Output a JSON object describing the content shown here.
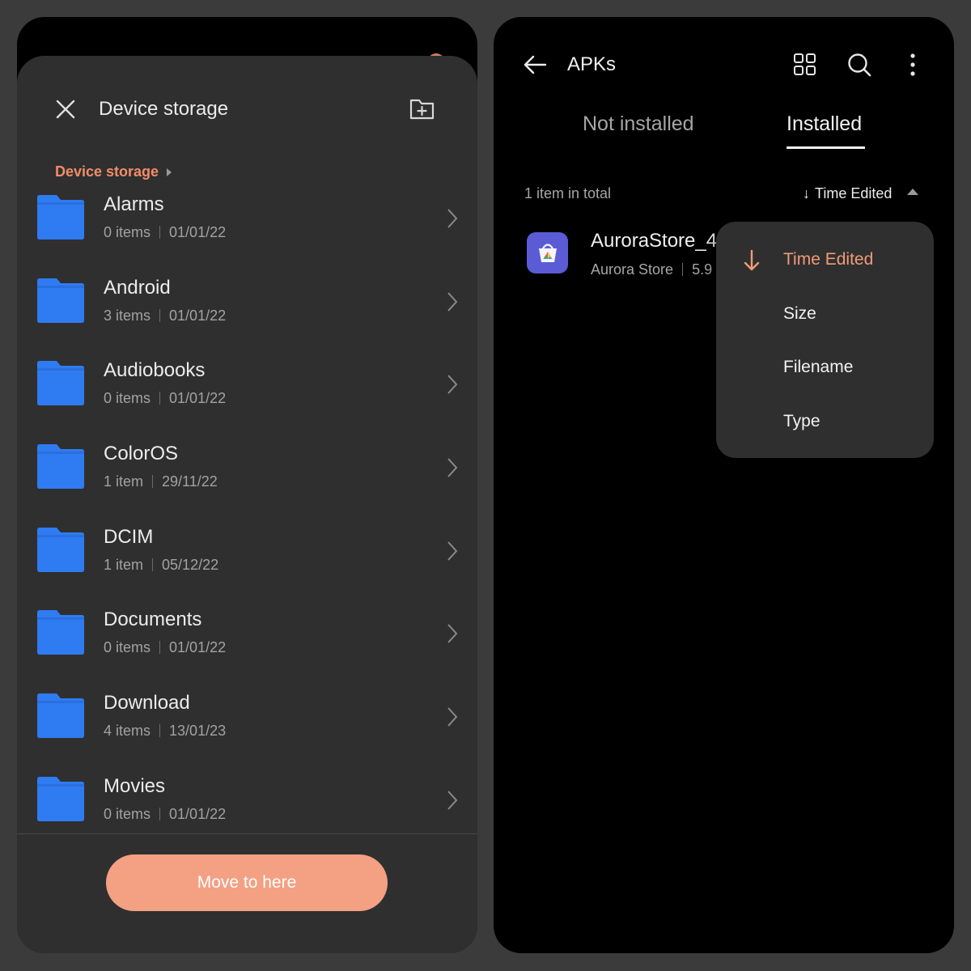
{
  "left": {
    "title": "Device storage",
    "breadcrumb": "Device storage",
    "folders": [
      {
        "name": "Alarms",
        "count": "0 items",
        "date": "01/01/22"
      },
      {
        "name": "Android",
        "count": "3 items",
        "date": "01/01/22"
      },
      {
        "name": "Audiobooks",
        "count": "0 items",
        "date": "01/01/22"
      },
      {
        "name": "ColorOS",
        "count": "1 item",
        "date": "29/11/22"
      },
      {
        "name": "DCIM",
        "count": "1 item",
        "date": "05/12/22"
      },
      {
        "name": "Documents",
        "count": "0 items",
        "date": "01/01/22"
      },
      {
        "name": "Download",
        "count": "4 items",
        "date": "13/01/23"
      },
      {
        "name": "Movies",
        "count": "0 items",
        "date": "01/01/22"
      }
    ],
    "move_button": "Move to here"
  },
  "right": {
    "title": "APKs",
    "tabs": {
      "not_installed": "Not installed",
      "installed": "Installed"
    },
    "item_count": "1 item in total",
    "sort_label": "Time Edited",
    "sort_arrow": "↓",
    "apk": {
      "name": "AuroraStore_4",
      "app": "Aurora Store",
      "size": "5.9"
    },
    "sort_menu": [
      {
        "label": "Time Edited",
        "selected": true
      },
      {
        "label": "Size",
        "selected": false
      },
      {
        "label": "Filename",
        "selected": false
      },
      {
        "label": "Type",
        "selected": false
      }
    ]
  },
  "colors": {
    "accent": "#f29a78",
    "button": "#f4a083",
    "folder": "#2f7bf2",
    "sheet": "#2f2f2f"
  }
}
